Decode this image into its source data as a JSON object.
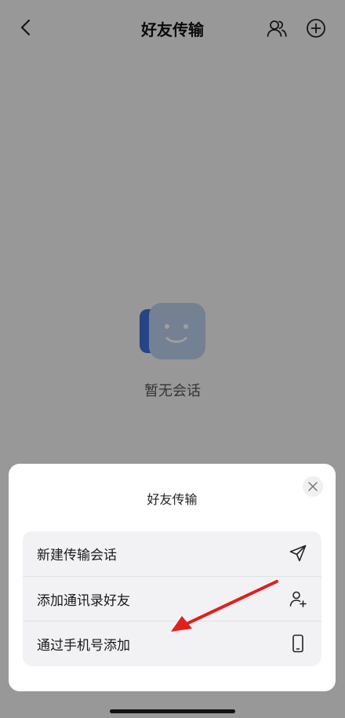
{
  "nav": {
    "title": "好友传输",
    "back_icon": "chevron-left-icon",
    "contacts_icon": "people-icon",
    "add_icon": "plus-circle-icon"
  },
  "empty_state": {
    "icon": "smiley-chat-icon",
    "text": "暂无会话"
  },
  "sheet": {
    "title": "好友传输",
    "close_icon": "close-icon",
    "items": [
      {
        "label": "新建传输会话",
        "icon": "send-icon"
      },
      {
        "label": "添加通讯录好友",
        "icon": "add-person-icon"
      },
      {
        "label": "通过手机号添加",
        "icon": "phone-icon"
      }
    ]
  },
  "annotation": {
    "arrow_color": "#e0201c"
  }
}
